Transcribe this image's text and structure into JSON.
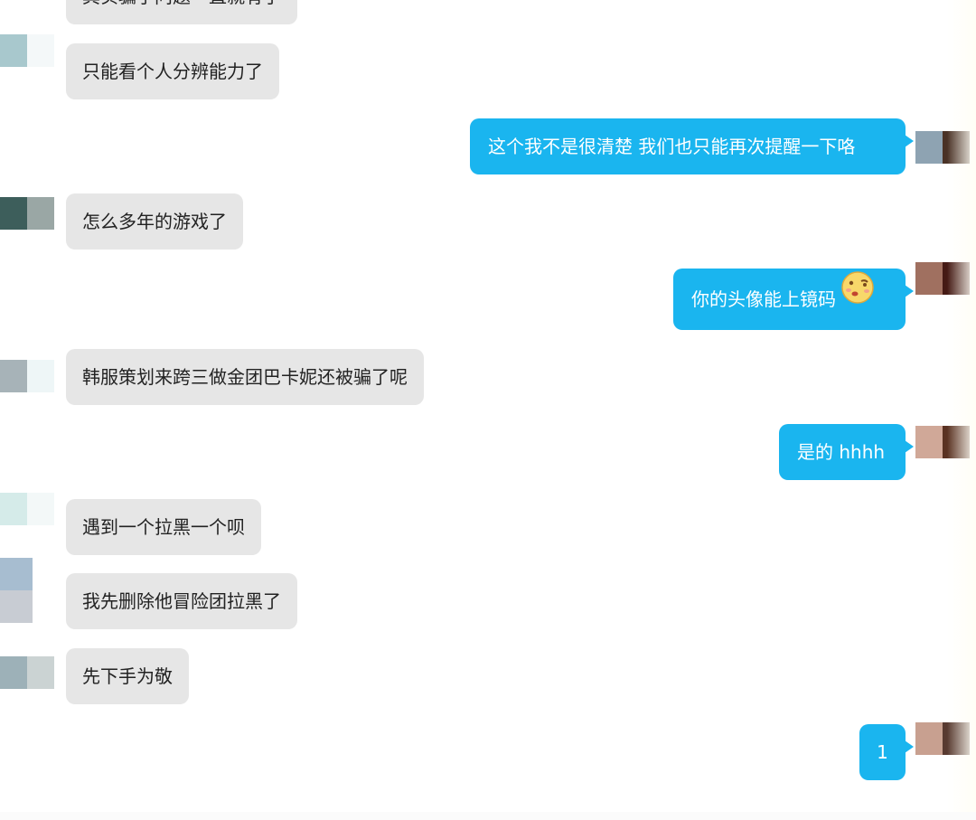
{
  "conversation": {
    "messages": [
      {
        "side": "in",
        "text": "其实骗子问题一直就有了"
      },
      {
        "side": "in",
        "text": "只能看个人分辨能力了"
      },
      {
        "side": "out",
        "text": "这个我不是很清楚  我们也只能再次提醒一下咯"
      },
      {
        "side": "in",
        "text": "怎么多年的游戏了"
      },
      {
        "side": "out",
        "text": "你的头像能上镜码",
        "emoji": "kiss-face-emoji"
      },
      {
        "side": "in",
        "text": "韩服策划来跨三做金团巴卡妮还被骗了呢"
      },
      {
        "side": "out",
        "text": "是的 hhhh"
      },
      {
        "side": "in",
        "text": "遇到一个拉黑一个呗"
      },
      {
        "side": "in",
        "text": "我先删除他冒险团拉黑了"
      },
      {
        "side": "in",
        "text": "先下手为敬"
      },
      {
        "side": "out",
        "text": "1"
      }
    ]
  },
  "colors": {
    "incoming_bubble": "#e6e6e6",
    "outgoing_bubble": "#1ab5ef",
    "incoming_text": "#222222",
    "outgoing_text": "#ffffff"
  }
}
